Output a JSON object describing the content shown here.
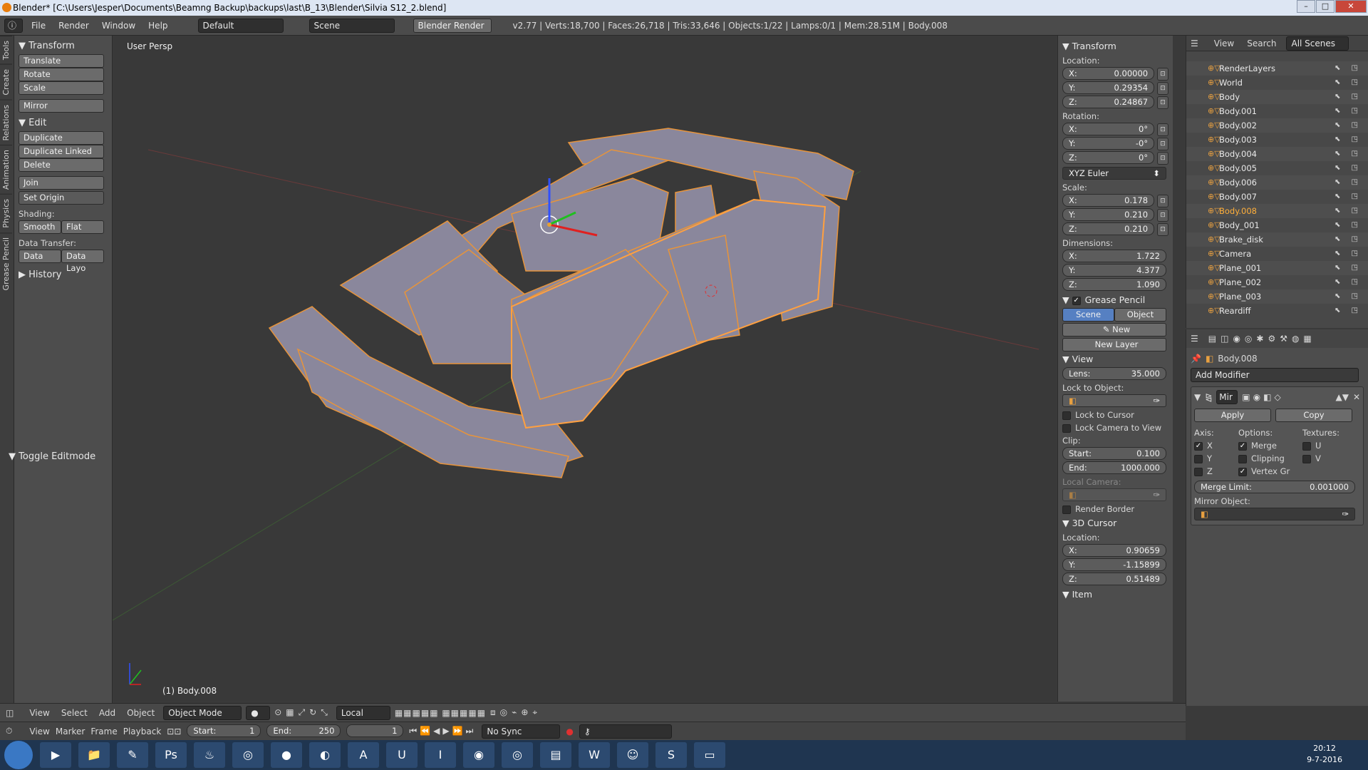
{
  "window": {
    "title": "Blender* [C:\\Users\\Jesper\\Documents\\Beamng Backup\\backups\\last\\B_13\\Blender\\Silvia S12_2.blend]"
  },
  "menu": {
    "file": "File",
    "render": "Render",
    "window": "Window",
    "help": "Help",
    "layout": "Default",
    "scene": "Scene",
    "engine": "Blender Render",
    "stats": "v2.77 | Verts:18,700 | Faces:26,718 | Tris:33,646 | Objects:1/22 | Lamps:0/1 | Mem:28.51M | Body.008"
  },
  "tabs": [
    "Tools",
    "Create",
    "Relations",
    "Animation",
    "Physics",
    "Grease Pencil"
  ],
  "toolshelf": {
    "transform_head": "Transform",
    "translate": "Translate",
    "rotate": "Rotate",
    "scale": "Scale",
    "mirror": "Mirror",
    "edit_head": "Edit",
    "duplicate": "Duplicate",
    "duplicate_linked": "Duplicate Linked",
    "delete": "Delete",
    "join": "Join",
    "set_origin": "Set Origin",
    "shading": "Shading:",
    "smooth": "Smooth",
    "flat": "Flat",
    "data_transfer": "Data Transfer:",
    "data": "Data",
    "data_layo": "Data Layo",
    "history": "History",
    "toggle_editmode": "Toggle Editmode"
  },
  "viewport": {
    "label": "User Persp",
    "object": "(1) Body.008"
  },
  "props": {
    "transform_head": "Transform",
    "location": "Location:",
    "loc": [
      {
        "a": "X:",
        "v": "0.00000"
      },
      {
        "a": "Y:",
        "v": "0.29354"
      },
      {
        "a": "Z:",
        "v": "0.24867"
      }
    ],
    "rotation": "Rotation:",
    "rot": [
      {
        "a": "X:",
        "v": "0°"
      },
      {
        "a": "Y:",
        "v": "-0°"
      },
      {
        "a": "Z:",
        "v": "0°"
      }
    ],
    "euler": "XYZ Euler",
    "scale": "Scale:",
    "scl": [
      {
        "a": "X:",
        "v": "0.178"
      },
      {
        "a": "Y:",
        "v": "0.210"
      },
      {
        "a": "Z:",
        "v": "0.210"
      }
    ],
    "dimensions": "Dimensions:",
    "dim": [
      {
        "a": "X:",
        "v": "1.722"
      },
      {
        "a": "Y:",
        "v": "4.377"
      },
      {
        "a": "Z:",
        "v": "1.090"
      }
    ],
    "grease_head": "Grease Pencil",
    "scene_tab": "Scene",
    "object_tab": "Object",
    "new": "New",
    "new_layer": "New Layer",
    "view_head": "View",
    "lens": "Lens:",
    "lens_v": "35.000",
    "lock_obj": "Lock to Object:",
    "lock_cursor": "Lock to Cursor",
    "lock_cam": "Lock Camera to View",
    "clip": "Clip:",
    "start": "Start:",
    "start_v": "0.100",
    "end": "End:",
    "end_v": "1000.000",
    "local_cam": "Local Camera:",
    "render_border": "Render Border",
    "cursor_head": "3D Cursor",
    "cursor_loc": "Location:",
    "cur": [
      {
        "a": "X:",
        "v": "0.90659"
      },
      {
        "a": "Y:",
        "v": "-1.15899"
      },
      {
        "a": "Z:",
        "v": "0.51489"
      }
    ],
    "item_head": "Item"
  },
  "outliner": {
    "view": "View",
    "search": "Search",
    "all_scenes": "All Scenes",
    "rows": [
      "RenderLayers",
      "World",
      "Body",
      "Body.001",
      "Body.002",
      "Body.003",
      "Body.004",
      "Body.005",
      "Body.006",
      "Body.007",
      "Body.008",
      "Body_001",
      "Brake_disk",
      "Camera",
      "Plane_001",
      "Plane_002",
      "Plane_003",
      "Reardiff"
    ]
  },
  "modifier": {
    "object": "Body.008",
    "add": "Add Modifier",
    "name": "Mir",
    "apply": "Apply",
    "copy": "Copy",
    "axis": "Axis:",
    "options": "Options:",
    "textures": "Textures:",
    "x": "X",
    "y": "Y",
    "z": "Z",
    "merge": "Merge",
    "clipping": "Clipping",
    "vertex": "Vertex Gr",
    "u": "U",
    "v": "V",
    "merge_limit": "Merge Limit:",
    "merge_limit_v": "0.001000",
    "mirror_obj": "Mirror Object:"
  },
  "header3d": {
    "view": "View",
    "select": "Select",
    "add": "Add",
    "object": "Object",
    "mode": "Object Mode",
    "orient": "Local"
  },
  "timeline": {
    "view": "View",
    "marker": "Marker",
    "frame": "Frame",
    "playback": "Playback",
    "start": "Start:",
    "start_v": "1",
    "end": "End:",
    "end_v": "250",
    "cur": "1",
    "sync": "No Sync"
  },
  "clock": {
    "time": "20:12",
    "date": "9-7-2016"
  }
}
